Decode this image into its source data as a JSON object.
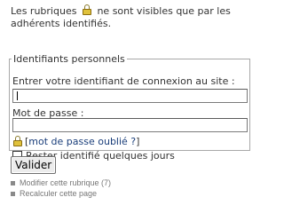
{
  "notice": {
    "text_before": "Les rubriques",
    "text_after": "ne sont visibles que par les adhérents identifiés."
  },
  "login_form": {
    "legend": "Identifiants personnels",
    "login_label": "Entrer votre identifiant de connexion au site  :",
    "login_value": "",
    "password_label": "Mot de passe :",
    "password_value": "",
    "forgot_link": "mot de passe oublié ?",
    "forgot_open": "[",
    "forgot_close": "]",
    "remember_label": "Rester identifié quelques jours",
    "remember_checked": false,
    "submit_label": "Valider"
  },
  "admin_links": [
    {
      "label": "Modifier cette rubrique (7)"
    },
    {
      "label": "Recalculer cette page"
    }
  ],
  "icons": {
    "lock": "lock-icon",
    "bullet": "square-bullet-icon"
  }
}
